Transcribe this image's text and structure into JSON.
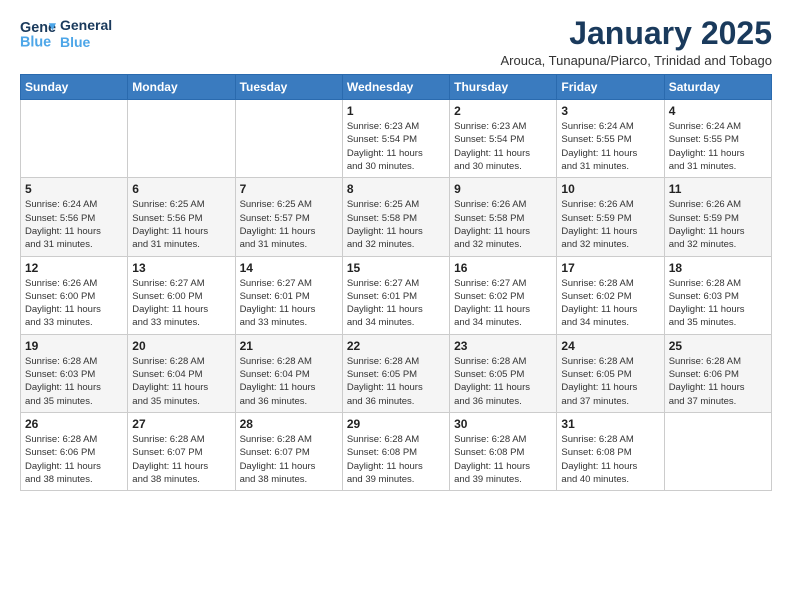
{
  "header": {
    "logo_line1": "General",
    "logo_line2": "Blue",
    "main_title": "January 2025",
    "subtitle": "Arouca, Tunapuna/Piarco, Trinidad and Tobago"
  },
  "weekdays": [
    "Sunday",
    "Monday",
    "Tuesday",
    "Wednesday",
    "Thursday",
    "Friday",
    "Saturday"
  ],
  "weeks": [
    [
      {
        "day": "",
        "info": ""
      },
      {
        "day": "",
        "info": ""
      },
      {
        "day": "",
        "info": ""
      },
      {
        "day": "1",
        "info": "Sunrise: 6:23 AM\nSunset: 5:54 PM\nDaylight: 11 hours\nand 30 minutes."
      },
      {
        "day": "2",
        "info": "Sunrise: 6:23 AM\nSunset: 5:54 PM\nDaylight: 11 hours\nand 30 minutes."
      },
      {
        "day": "3",
        "info": "Sunrise: 6:24 AM\nSunset: 5:55 PM\nDaylight: 11 hours\nand 31 minutes."
      },
      {
        "day": "4",
        "info": "Sunrise: 6:24 AM\nSunset: 5:55 PM\nDaylight: 11 hours\nand 31 minutes."
      }
    ],
    [
      {
        "day": "5",
        "info": "Sunrise: 6:24 AM\nSunset: 5:56 PM\nDaylight: 11 hours\nand 31 minutes."
      },
      {
        "day": "6",
        "info": "Sunrise: 6:25 AM\nSunset: 5:56 PM\nDaylight: 11 hours\nand 31 minutes."
      },
      {
        "day": "7",
        "info": "Sunrise: 6:25 AM\nSunset: 5:57 PM\nDaylight: 11 hours\nand 31 minutes."
      },
      {
        "day": "8",
        "info": "Sunrise: 6:25 AM\nSunset: 5:58 PM\nDaylight: 11 hours\nand 32 minutes."
      },
      {
        "day": "9",
        "info": "Sunrise: 6:26 AM\nSunset: 5:58 PM\nDaylight: 11 hours\nand 32 minutes."
      },
      {
        "day": "10",
        "info": "Sunrise: 6:26 AM\nSunset: 5:59 PM\nDaylight: 11 hours\nand 32 minutes."
      },
      {
        "day": "11",
        "info": "Sunrise: 6:26 AM\nSunset: 5:59 PM\nDaylight: 11 hours\nand 32 minutes."
      }
    ],
    [
      {
        "day": "12",
        "info": "Sunrise: 6:26 AM\nSunset: 6:00 PM\nDaylight: 11 hours\nand 33 minutes."
      },
      {
        "day": "13",
        "info": "Sunrise: 6:27 AM\nSunset: 6:00 PM\nDaylight: 11 hours\nand 33 minutes."
      },
      {
        "day": "14",
        "info": "Sunrise: 6:27 AM\nSunset: 6:01 PM\nDaylight: 11 hours\nand 33 minutes."
      },
      {
        "day": "15",
        "info": "Sunrise: 6:27 AM\nSunset: 6:01 PM\nDaylight: 11 hours\nand 34 minutes."
      },
      {
        "day": "16",
        "info": "Sunrise: 6:27 AM\nSunset: 6:02 PM\nDaylight: 11 hours\nand 34 minutes."
      },
      {
        "day": "17",
        "info": "Sunrise: 6:28 AM\nSunset: 6:02 PM\nDaylight: 11 hours\nand 34 minutes."
      },
      {
        "day": "18",
        "info": "Sunrise: 6:28 AM\nSunset: 6:03 PM\nDaylight: 11 hours\nand 35 minutes."
      }
    ],
    [
      {
        "day": "19",
        "info": "Sunrise: 6:28 AM\nSunset: 6:03 PM\nDaylight: 11 hours\nand 35 minutes."
      },
      {
        "day": "20",
        "info": "Sunrise: 6:28 AM\nSunset: 6:04 PM\nDaylight: 11 hours\nand 35 minutes."
      },
      {
        "day": "21",
        "info": "Sunrise: 6:28 AM\nSunset: 6:04 PM\nDaylight: 11 hours\nand 36 minutes."
      },
      {
        "day": "22",
        "info": "Sunrise: 6:28 AM\nSunset: 6:05 PM\nDaylight: 11 hours\nand 36 minutes."
      },
      {
        "day": "23",
        "info": "Sunrise: 6:28 AM\nSunset: 6:05 PM\nDaylight: 11 hours\nand 36 minutes."
      },
      {
        "day": "24",
        "info": "Sunrise: 6:28 AM\nSunset: 6:05 PM\nDaylight: 11 hours\nand 37 minutes."
      },
      {
        "day": "25",
        "info": "Sunrise: 6:28 AM\nSunset: 6:06 PM\nDaylight: 11 hours\nand 37 minutes."
      }
    ],
    [
      {
        "day": "26",
        "info": "Sunrise: 6:28 AM\nSunset: 6:06 PM\nDaylight: 11 hours\nand 38 minutes."
      },
      {
        "day": "27",
        "info": "Sunrise: 6:28 AM\nSunset: 6:07 PM\nDaylight: 11 hours\nand 38 minutes."
      },
      {
        "day": "28",
        "info": "Sunrise: 6:28 AM\nSunset: 6:07 PM\nDaylight: 11 hours\nand 38 minutes."
      },
      {
        "day": "29",
        "info": "Sunrise: 6:28 AM\nSunset: 6:08 PM\nDaylight: 11 hours\nand 39 minutes."
      },
      {
        "day": "30",
        "info": "Sunrise: 6:28 AM\nSunset: 6:08 PM\nDaylight: 11 hours\nand 39 minutes."
      },
      {
        "day": "31",
        "info": "Sunrise: 6:28 AM\nSunset: 6:08 PM\nDaylight: 11 hours\nand 40 minutes."
      },
      {
        "day": "",
        "info": ""
      }
    ]
  ]
}
